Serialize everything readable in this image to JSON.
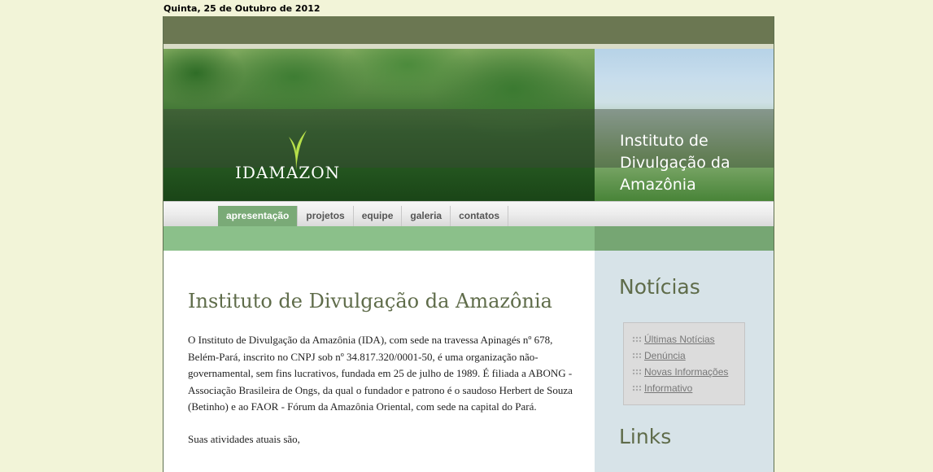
{
  "date": "Quinta, 25 de Outubro de 2012",
  "banner": {
    "logo_text": "IDAMAZON",
    "title_lines": [
      "Instituto de",
      "Divulgação da",
      "Amazônia"
    ]
  },
  "nav": {
    "items": [
      {
        "label": "apresentação",
        "active": true
      },
      {
        "label": "projetos",
        "active": false
      },
      {
        "label": "equipe",
        "active": false
      },
      {
        "label": "galeria",
        "active": false
      },
      {
        "label": "contatos",
        "active": false
      }
    ]
  },
  "main": {
    "heading": "Instituto de Divulgação da Amazônia",
    "paragraph1": "O Instituto de Divulgação da Amazônia (IDA), com sede na travessa Apinagés nº 678, Belém-Pará, inscrito no CNPJ sob nº 34.817.320/0001-50, é uma organização não-governamental, sem fins lucrativos, fundada em 25 de julho de 1989. É filiada a ABONG - Associação Brasileira de Ongs, da qual o fundador e patrono é o saudoso Herbert de Souza (Betinho) e ao FAOR - Fórum da Amazônia Oriental, com sede na capital do Pará.",
    "paragraph2": "Suas atividades atuais são,"
  },
  "sidebar": {
    "news_title": "Notícias",
    "news_links": [
      "Últimas Notícias",
      "Denúncia",
      "Novas Informações",
      "Informativo"
    ],
    "links_title": "Links"
  },
  "colors": {
    "page_bg": "#f2f4d8",
    "top_bar": "#6b7752",
    "nav_active": "#7aaa77",
    "green_bar": "#8bc08a",
    "sidebar_bg": "#d7e3e8",
    "heading": "#5f6c4a"
  }
}
